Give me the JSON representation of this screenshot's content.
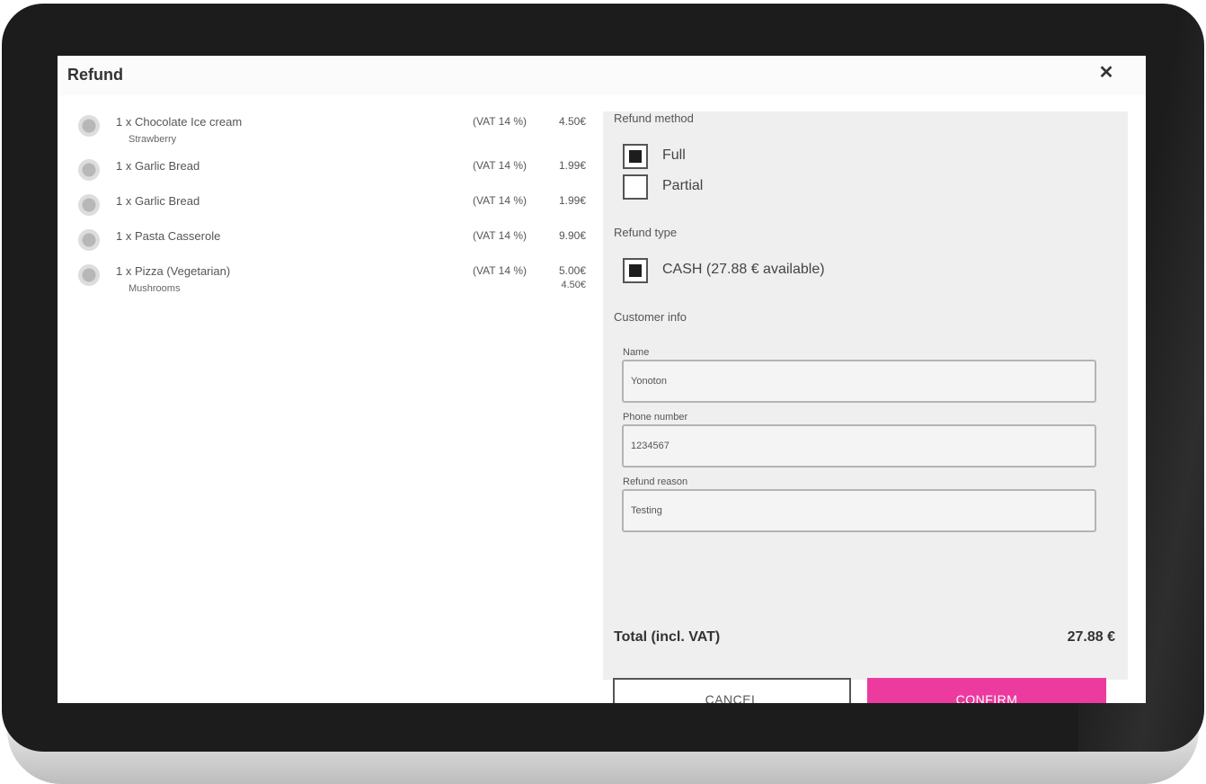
{
  "dialog": {
    "title": "Refund",
    "close_symbol": "✕"
  },
  "items": [
    {
      "name": "1 x Chocolate Ice cream",
      "modifier": "Strawberry",
      "vat": "(VAT 14 %)",
      "price": "4.50€",
      "modifier_price": ""
    },
    {
      "name": "1 x Garlic Bread",
      "modifier": "",
      "vat": "(VAT 14 %)",
      "price": "1.99€",
      "modifier_price": ""
    },
    {
      "name": "1 x Garlic Bread",
      "modifier": "",
      "vat": "(VAT 14 %)",
      "price": "1.99€",
      "modifier_price": ""
    },
    {
      "name": "1 x Pasta Casserole",
      "modifier": "",
      "vat": "(VAT 14 %)",
      "price": "9.90€",
      "modifier_price": ""
    },
    {
      "name": "1 x Pizza (Vegetarian)",
      "modifier": "Mushrooms",
      "vat": "(VAT 14 %)",
      "price": "5.00€",
      "modifier_price": "4.50€"
    }
  ],
  "refund_method": {
    "label": "Refund method",
    "options": [
      {
        "label": "Full",
        "checked": true
      },
      {
        "label": "Partial",
        "checked": false
      }
    ]
  },
  "refund_type": {
    "label": "Refund type",
    "options": [
      {
        "label": "CASH (27.88 € available)",
        "checked": true
      }
    ]
  },
  "customer_info": {
    "label": "Customer info",
    "name": {
      "label": "Name",
      "value": "Yonoton"
    },
    "phone": {
      "label": "Phone number",
      "value": "1234567"
    },
    "reason": {
      "label": "Refund reason",
      "value": "Testing"
    }
  },
  "total": {
    "label": "Total (incl. VAT)",
    "value": "27.88 €"
  },
  "buttons": {
    "cancel": "CANCEL",
    "confirm": "CONFIRM"
  },
  "colors": {
    "accent": "#ec3a9f",
    "bezel": "#1c1c1c",
    "panel": "#efefef"
  }
}
